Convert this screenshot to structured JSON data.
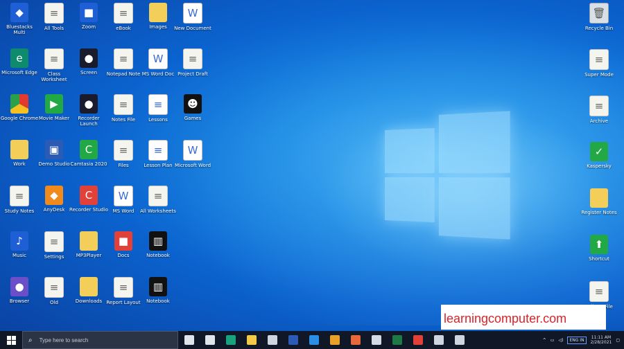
{
  "desktop": {
    "icons_left": [
      {
        "label": "Bluestacks Multi",
        "icon": "bluestacks-icon",
        "style": "g-blue",
        "glyph": "◆"
      },
      {
        "label": "All Tools",
        "icon": "file-icon",
        "style": "g-file",
        "glyph": "≡"
      },
      {
        "label": "Zoom",
        "icon": "zoom-icon",
        "style": "g-blue",
        "glyph": "■"
      },
      {
        "label": "eBook",
        "icon": "file-icon",
        "style": "g-file",
        "glyph": "≡"
      },
      {
        "label": "Images",
        "icon": "folder-icon",
        "style": "g-folder",
        "glyph": ""
      },
      {
        "label": "New Document",
        "icon": "word-doc-icon",
        "style": "g-white",
        "glyph": "W"
      },
      {
        "label": "Microsoft Edge",
        "icon": "edge-icon",
        "style": "g-edge",
        "glyph": "e"
      },
      {
        "label": "Class Worksheet",
        "icon": "file-icon",
        "style": "g-file",
        "glyph": "≡"
      },
      {
        "label": "Screen",
        "icon": "app-dark-icon",
        "style": "g-dark",
        "glyph": "●"
      },
      {
        "label": "Notepad Note",
        "icon": "file-icon",
        "style": "g-file",
        "glyph": "≡"
      },
      {
        "label": "MS Word Doc",
        "icon": "word-doc-icon",
        "style": "g-white",
        "glyph": "W"
      },
      {
        "label": "Project Draft",
        "icon": "file-icon",
        "style": "g-file",
        "glyph": "≡"
      },
      {
        "label": "Google Chrome",
        "icon": "chrome-icon",
        "style": "g-chrome",
        "glyph": ""
      },
      {
        "label": "Movie Maker",
        "icon": "movie-icon",
        "style": "g-green",
        "glyph": "▶"
      },
      {
        "label": "Recorder Launch",
        "icon": "app-dark-icon",
        "style": "g-dark",
        "glyph": "●"
      },
      {
        "label": "Notes File",
        "icon": "file-icon",
        "style": "g-file",
        "glyph": "≡"
      },
      {
        "label": "Lessons",
        "icon": "document-icon",
        "style": "g-white",
        "glyph": "≡"
      },
      {
        "label": "Games",
        "icon": "game-icon",
        "style": "g-black",
        "glyph": "☻"
      },
      {
        "label": "Work",
        "icon": "folder-icon",
        "style": "g-folder",
        "glyph": ""
      },
      {
        "label": "Demo Studio",
        "icon": "app-blue-icon",
        "style": "g-word",
        "glyph": "▣"
      },
      {
        "label": "Camtasia 2020",
        "icon": "camtasia-icon",
        "style": "g-green",
        "glyph": "C"
      },
      {
        "label": "Files",
        "icon": "file-icon",
        "style": "g-file",
        "glyph": "≡"
      },
      {
        "label": "Lesson Plan",
        "icon": "document-icon",
        "style": "g-white",
        "glyph": "≡"
      },
      {
        "label": "Microsoft Word",
        "icon": "word-doc-icon",
        "style": "g-white",
        "glyph": "W"
      },
      {
        "label": "Study Notes",
        "icon": "file-icon",
        "style": "g-file",
        "glyph": "≡"
      },
      {
        "label": "AnyDesk",
        "icon": "anydesk-icon",
        "style": "g-orange",
        "glyph": "◆"
      },
      {
        "label": "Recorder Studio",
        "icon": "camtasia-icon",
        "style": "g-red",
        "glyph": "C"
      },
      {
        "label": "MS Word",
        "icon": "word-doc-icon",
        "style": "g-white",
        "glyph": "W"
      },
      {
        "label": "All Worksheets",
        "icon": "file-icon",
        "style": "g-file",
        "glyph": "≡"
      },
      {
        "label": "",
        "icon": "",
        "style": "",
        "glyph": ""
      },
      {
        "label": "Music",
        "icon": "music-icon",
        "style": "g-blue",
        "glyph": "♪"
      },
      {
        "label": "Settings",
        "icon": "file-icon",
        "style": "g-file",
        "glyph": "≡"
      },
      {
        "label": "MP3Player",
        "icon": "folder-icon",
        "style": "g-folder",
        "glyph": ""
      },
      {
        "label": "Docs",
        "icon": "app-red-icon",
        "style": "g-red",
        "glyph": "■"
      },
      {
        "label": "Notebook",
        "icon": "archive-icon",
        "style": "g-black",
        "glyph": "▥"
      },
      {
        "label": "",
        "icon": "",
        "style": "",
        "glyph": ""
      },
      {
        "label": "Browser",
        "icon": "globe-icon",
        "style": "g-purple",
        "glyph": "●"
      },
      {
        "label": "Old",
        "icon": "file-icon",
        "style": "g-file",
        "glyph": "≡"
      },
      {
        "label": "Downloads",
        "icon": "folder-icon",
        "style": "g-folder",
        "glyph": ""
      },
      {
        "label": "Report Layout",
        "icon": "file-icon",
        "style": "g-file",
        "glyph": "≡"
      },
      {
        "label": "Notebook",
        "icon": "archive-icon",
        "style": "g-black",
        "glyph": "▥"
      },
      {
        "label": "",
        "icon": "",
        "style": "",
        "glyph": ""
      }
    ],
    "icons_right": [
      {
        "label": "Recycle Bin",
        "icon": "recycle-bin-icon",
        "style": "g-bin",
        "glyph": "🗑"
      },
      {
        "label": "Super Mode",
        "icon": "file-icon",
        "style": "g-file",
        "glyph": "≡"
      },
      {
        "label": "Archive",
        "icon": "file-icon",
        "style": "g-file",
        "glyph": "≡"
      },
      {
        "label": "Kaspersky",
        "icon": "shield-check-icon",
        "style": "g-green",
        "glyph": "✓"
      },
      {
        "label": "Register Notes",
        "icon": "folder-icon",
        "style": "g-folder",
        "glyph": ""
      },
      {
        "label": "Shortcut",
        "icon": "arrow-icon",
        "style": "g-green",
        "glyph": "⬆"
      },
      {
        "label": "Full Set File",
        "icon": "file-icon",
        "style": "g-file",
        "glyph": "≡"
      }
    ]
  },
  "watermark": {
    "text": "learningcomputer.com"
  },
  "taskbar": {
    "search_placeholder": "Type here to search",
    "apps": [
      {
        "icon": "task-view-icon",
        "color": "#dfe3ea"
      },
      {
        "icon": "cortana-icon",
        "color": "#dfe3ea"
      },
      {
        "icon": "edge-icon",
        "color": "#19a37c"
      },
      {
        "icon": "file-explorer-icon",
        "color": "#f3c94a"
      },
      {
        "icon": "store-icon",
        "color": "#cfd5de"
      },
      {
        "icon": "word-icon",
        "color": "#2b5bb5"
      },
      {
        "icon": "vscode-icon",
        "color": "#2a8ee6"
      },
      {
        "icon": "chrome-icon",
        "color": "#e7a02a"
      },
      {
        "icon": "powerpoint-icon",
        "color": "#e6683b"
      },
      {
        "icon": "notepad-icon",
        "color": "#d5dbe4"
      },
      {
        "icon": "excel-icon",
        "color": "#1d7a44"
      },
      {
        "icon": "recorder-icon",
        "color": "#e2413a"
      },
      {
        "icon": "snip-icon",
        "color": "#cfd5de"
      },
      {
        "icon": "settings-icon",
        "color": "#cfd5de"
      }
    ],
    "tray": {
      "language": "ENG IN",
      "time": "11:11 AM",
      "date": "2/28/2021"
    }
  }
}
